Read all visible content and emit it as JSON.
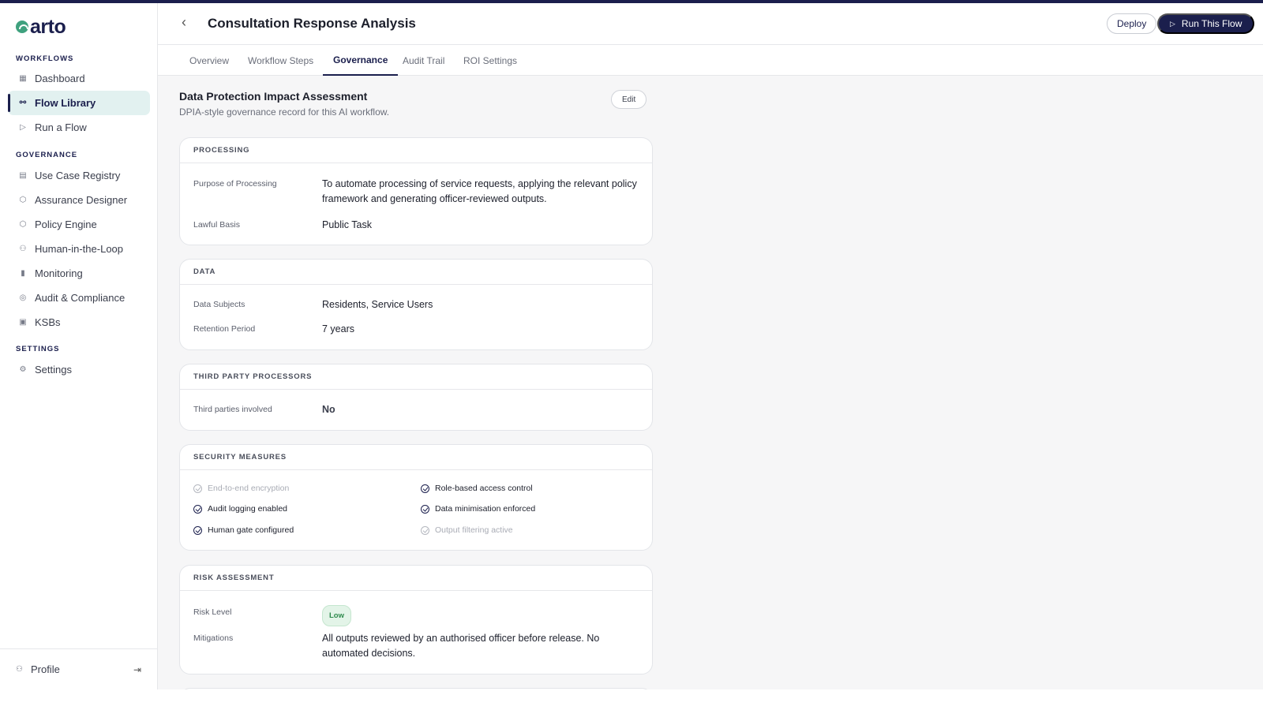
{
  "app": {
    "logo_text": "arto",
    "brand_color": "#1b1f4d",
    "accent_color": "#3fa17e"
  },
  "sidebar": {
    "sections": [
      {
        "label": "WORKFLOWS",
        "items": [
          {
            "label": "Dashboard",
            "icon": "grid-icon"
          },
          {
            "label": "Flow Library",
            "icon": "flow-icon",
            "active": true
          },
          {
            "label": "Run a Flow",
            "icon": "play-icon"
          }
        ]
      },
      {
        "label": "GOVERNANCE",
        "items": [
          {
            "label": "Use Case Registry",
            "icon": "registry-icon"
          },
          {
            "label": "Assurance Designer",
            "icon": "shield-icon"
          },
          {
            "label": "Policy Engine",
            "icon": "shield-icon"
          },
          {
            "label": "Human-in-the-Loop",
            "icon": "user-icon"
          },
          {
            "label": "Monitoring",
            "icon": "bar-chart-icon"
          },
          {
            "label": "Audit & Compliance",
            "icon": "check-circle-icon"
          },
          {
            "label": "KSBs",
            "icon": "book-icon"
          }
        ]
      },
      {
        "label": "SETTINGS",
        "items": [
          {
            "label": "Settings",
            "icon": "gear-icon"
          }
        ]
      }
    ],
    "footer": {
      "label": "Profile",
      "icon": "user-icon",
      "action_icon": "logout-icon"
    }
  },
  "header": {
    "title": "Consultation Response Analysis",
    "deploy_label": "Deploy",
    "run_label": "Run This Flow"
  },
  "tabs": [
    {
      "label": "Overview"
    },
    {
      "label": "Workflow Steps"
    },
    {
      "label": "Governance",
      "active": true
    },
    {
      "label": "Audit Trail"
    },
    {
      "label": "ROI Settings"
    }
  ],
  "content": {
    "title": "Data Protection Impact Assessment",
    "subtitle": "DPIA-style governance record for this AI workflow.",
    "edit_label": "Edit"
  },
  "processing": {
    "heading": "PROCESSING",
    "purpose_label": "Purpose of Processing",
    "purpose_value": "To automate processing of service requests, applying the relevant policy framework and generating officer-reviewed outputs.",
    "basis_label": "Lawful Basis",
    "basis_value": "Public Task"
  },
  "data_card": {
    "heading": "DATA",
    "subjects_label": "Data Subjects",
    "subjects_value": "Residents, Service Users",
    "retention_label": "Retention Period",
    "retention_value": "7 years"
  },
  "third_party": {
    "heading": "THIRD PARTY PROCESSORS",
    "label": "Third parties involved",
    "value": "No"
  },
  "security": {
    "heading": "SECURITY MEASURES",
    "items": [
      {
        "label": "End-to-end encryption",
        "enabled": false
      },
      {
        "label": "Role-based access control",
        "enabled": true
      },
      {
        "label": "Audit logging enabled",
        "enabled": true
      },
      {
        "label": "Data minimisation enforced",
        "enabled": true
      },
      {
        "label": "Human gate configured",
        "enabled": true
      },
      {
        "label": "Output filtering active",
        "enabled": false
      }
    ]
  },
  "risk": {
    "heading": "RISK ASSESSMENT",
    "level_label": "Risk Level",
    "level_value": "Low",
    "level_color": "#2f8a4d",
    "mitigations_label": "Mitigations",
    "mitigations_value": "All outputs reviewed by an authorised officer before release. No automated decisions."
  }
}
